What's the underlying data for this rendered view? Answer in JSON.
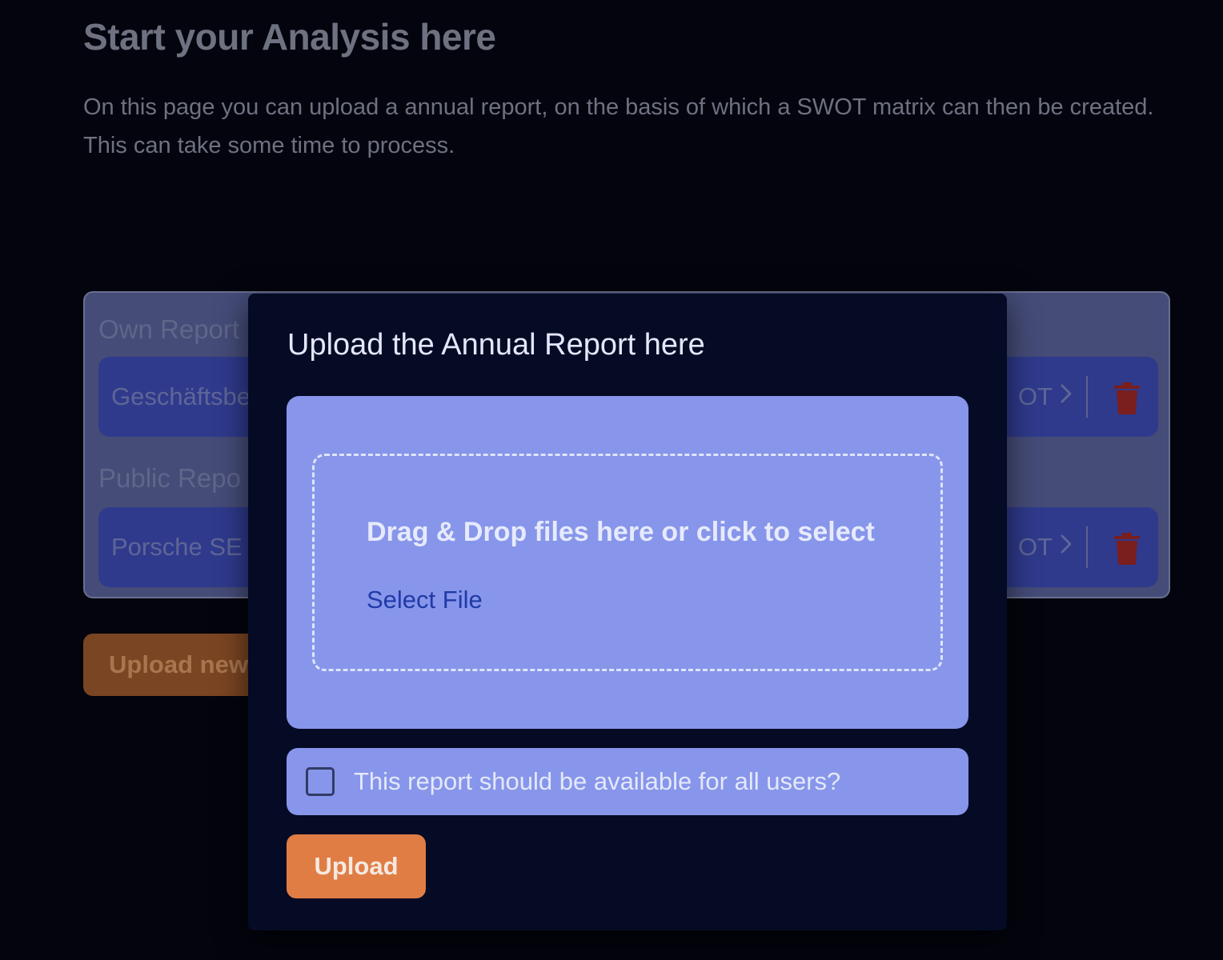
{
  "page": {
    "title": "Start your Analysis here",
    "description": "On this page you can upload a annual report, on the basis of which a SWOT matrix can then be created. This can take some time to process."
  },
  "reports": {
    "own_section_label": "Own Report",
    "own_items": [
      {
        "name": "Geschäftsbe",
        "action": "OT"
      }
    ],
    "public_section_label": "Public Repo",
    "public_items": [
      {
        "name": "Porsche SE",
        "action": "OT"
      }
    ]
  },
  "upload_new_button": {
    "label": "Upload new"
  },
  "modal": {
    "title": "Upload the Annual Report here",
    "dropzone": {
      "text": "Drag & Drop files here or click to select",
      "select_label": "Select File"
    },
    "public_checkbox": {
      "label": "This report should be available for all users?",
      "checked": false
    },
    "upload_button": {
      "label": "Upload"
    }
  },
  "colors": {
    "background": "#03040d",
    "modal_bg": "#050b24",
    "card_bg": "#8796ea",
    "accent_orange": "#e07d45",
    "link_blue": "#213aa8",
    "delete_red": "#8a1f1f"
  },
  "icons": {
    "chevron": "chevron-right-icon",
    "delete": "trash-icon"
  }
}
